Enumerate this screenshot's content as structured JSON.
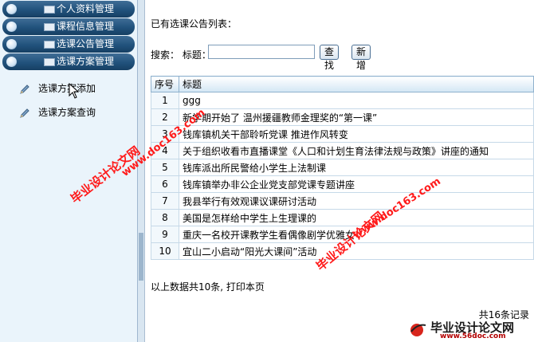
{
  "sidebar": {
    "menus": [
      {
        "label": "个人资料管理"
      },
      {
        "label": "课程信息管理"
      },
      {
        "label": "选课公告管理"
      },
      {
        "label": "选课方案管理"
      }
    ],
    "sub_items": [
      {
        "label": "选课方案添加"
      },
      {
        "label": "选课方案查询"
      }
    ]
  },
  "main": {
    "list_title": "已有选课公告列表：",
    "search": {
      "label": "搜索：  标题：",
      "value": "",
      "find_button": "查找",
      "new_button": "新增"
    },
    "table": {
      "headers": [
        "序号",
        "标题"
      ],
      "rows": [
        {
          "no": "1",
          "title": "ggg"
        },
        {
          "no": "2",
          "title": "新学期开始了 温州援疆教师金理奖的“第一课”"
        },
        {
          "no": "3",
          "title": "钱库镇机关干部聆听党课 推进作风转变"
        },
        {
          "no": "4",
          "title": "关于组织收看市直播课堂《人口和计划生育法律法规与政策》讲座的通知"
        },
        {
          "no": "5",
          "title": "钱库派出所民警给小学生上法制课"
        },
        {
          "no": "6",
          "title": "钱库镇举办非公企业党支部党课专题讲座"
        },
        {
          "no": "7",
          "title": "我县举行有效观课议课研讨活动"
        },
        {
          "no": "8",
          "title": "美国是怎样给中学生上生理课的"
        },
        {
          "no": "9",
          "title": "重庆一名校开课教学生看偶像剧学优雅女"
        },
        {
          "no": "10",
          "title": "宜山二小启动“阳光大课间”活动"
        }
      ]
    },
    "summary": "以上数据共10条, 打印本页",
    "total": "共16条记录"
  },
  "watermarks": {
    "site_name": "毕业设计论文网",
    "url": "www.doc163.com"
  },
  "logo": {
    "title": "毕业设计论文网",
    "url": "www.56doc.com"
  },
  "colors": {
    "menu_bg": "#21527c",
    "sidebar_bg": "#eaf4fb",
    "header_row": "#d3e6f4",
    "watermark": "#ff1a1a"
  }
}
